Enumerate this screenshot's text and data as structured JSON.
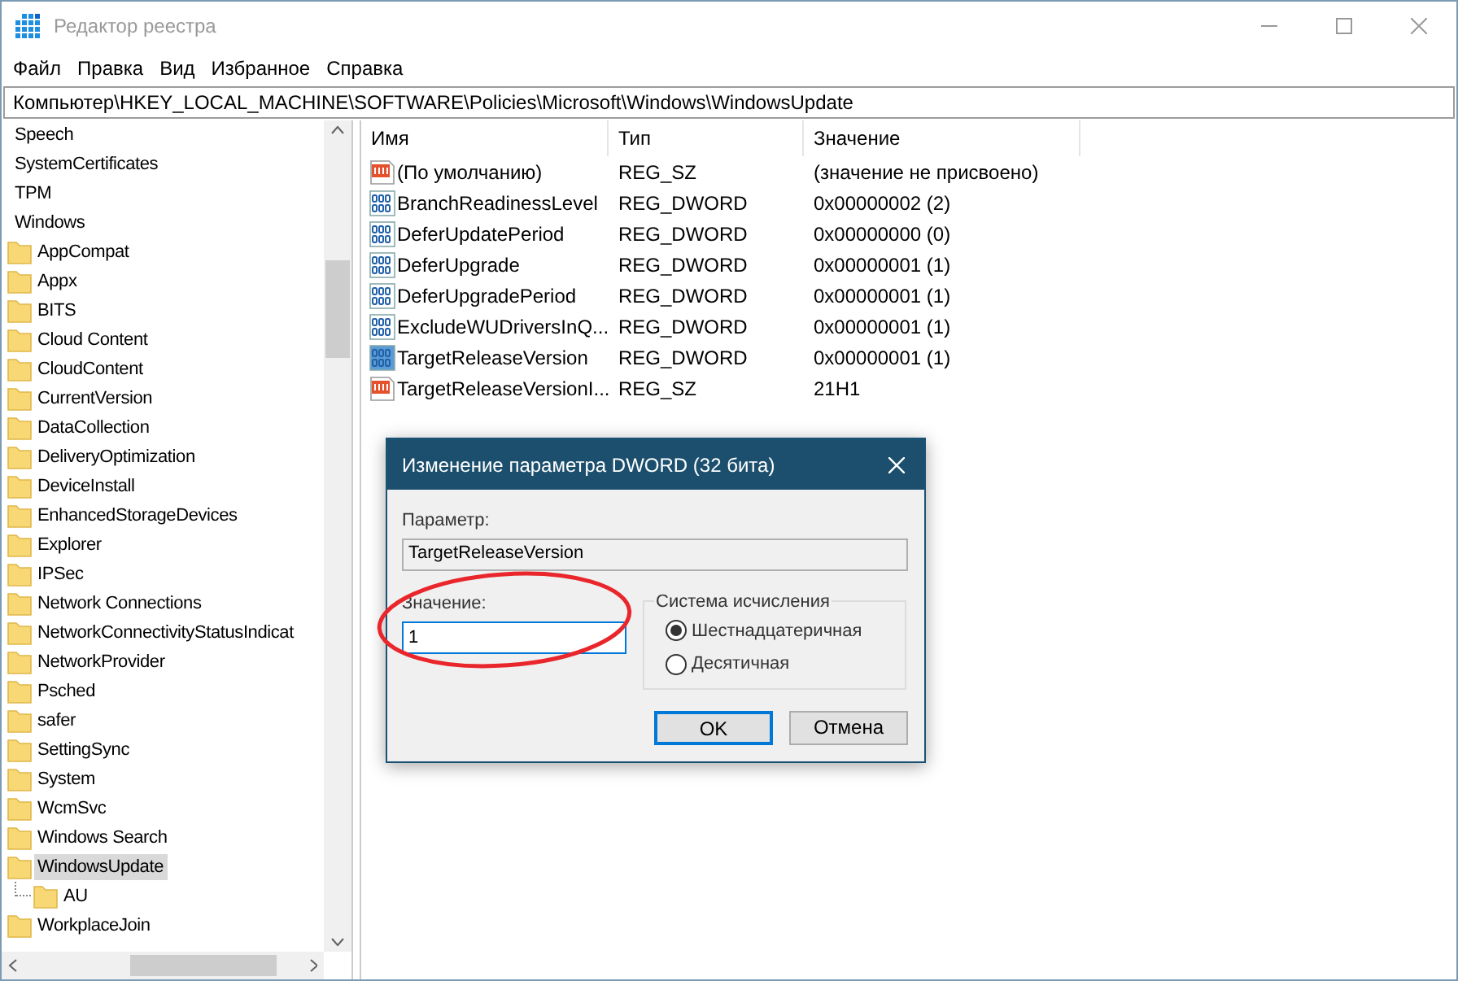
{
  "window": {
    "title": "Редактор реестра"
  },
  "menu": [
    "Файл",
    "Правка",
    "Вид",
    "Избранное",
    "Справка"
  ],
  "address": "Компьютер\\HKEY_LOCAL_MACHINE\\SOFTWARE\\Policies\\Microsoft\\Windows\\WindowsUpdate",
  "tree": {
    "items": [
      {
        "label": "Speech",
        "selected": false
      },
      {
        "label": "SystemCertificates",
        "selected": false
      },
      {
        "label": "TPM",
        "selected": false
      },
      {
        "label": "Windows",
        "selected": false,
        "children": [
          {
            "label": "AppCompat",
            "selected": false
          },
          {
            "label": "Appx",
            "selected": false
          },
          {
            "label": "BITS",
            "selected": false
          },
          {
            "label": "Cloud Content",
            "selected": false
          },
          {
            "label": "CloudContent",
            "selected": false
          },
          {
            "label": "CurrentVersion",
            "selected": false
          },
          {
            "label": "DataCollection",
            "selected": false
          },
          {
            "label": "DeliveryOptimization",
            "selected": false
          },
          {
            "label": "DeviceInstall",
            "selected": false
          },
          {
            "label": "EnhancedStorageDevices",
            "selected": false
          },
          {
            "label": "Explorer",
            "selected": false
          },
          {
            "label": "IPSec",
            "selected": false
          },
          {
            "label": "Network Connections",
            "selected": false
          },
          {
            "label": "NetworkConnectivityStatusIndicat",
            "selected": false
          },
          {
            "label": "NetworkProvider",
            "selected": false
          },
          {
            "label": "Psched",
            "selected": false
          },
          {
            "label": "safer",
            "selected": false
          },
          {
            "label": "SettingSync",
            "selected": false
          },
          {
            "label": "System",
            "selected": false
          },
          {
            "label": "WcmSvc",
            "selected": false
          },
          {
            "label": "Windows Search",
            "selected": false
          },
          {
            "label": "WindowsUpdate",
            "selected": true,
            "children": [
              {
                "label": "AU",
                "selected": false
              }
            ]
          },
          {
            "label": "WorkplaceJoin",
            "selected": false
          }
        ]
      }
    ]
  },
  "table": {
    "columns": [
      "Имя",
      "Тип",
      "Значение"
    ],
    "rows": [
      {
        "kind": "string",
        "name": "(По умолчанию)",
        "type": "REG_SZ",
        "value": "(значение не присвоено)",
        "selected": false
      },
      {
        "kind": "binary",
        "name": "BranchReadinessLevel",
        "type": "REG_DWORD",
        "value": "0x00000002 (2)",
        "selected": false
      },
      {
        "kind": "binary",
        "name": "DeferUpdatePeriod",
        "type": "REG_DWORD",
        "value": "0x00000000 (0)",
        "selected": false
      },
      {
        "kind": "binary",
        "name": "DeferUpgrade",
        "type": "REG_DWORD",
        "value": "0x00000001 (1)",
        "selected": false
      },
      {
        "kind": "binary",
        "name": "DeferUpgradePeriod",
        "type": "REG_DWORD",
        "value": "0x00000001 (1)",
        "selected": false
      },
      {
        "kind": "binary",
        "name": "ExcludeWUDriversInQ...",
        "type": "REG_DWORD",
        "value": "0x00000001 (1)",
        "selected": false
      },
      {
        "kind": "binary",
        "name": "TargetReleaseVersion",
        "type": "REG_DWORD",
        "value": "0x00000001 (1)",
        "selected": true
      },
      {
        "kind": "string",
        "name": "TargetReleaseVersionI...",
        "type": "REG_SZ",
        "value": "21H1",
        "selected": false
      }
    ]
  },
  "dialog": {
    "title": "Изменение параметра DWORD (32 бита)",
    "param_label": "Параметр:",
    "param_value": "TargetReleaseVersion",
    "value_label": "Значение:",
    "value": "1",
    "group_title": "Система исчисления",
    "radios": [
      {
        "label": "Шестнадцатеричная",
        "selected": true
      },
      {
        "label": "Десятичная",
        "selected": false
      }
    ],
    "buttons": [
      "OK",
      "Отмена"
    ]
  }
}
